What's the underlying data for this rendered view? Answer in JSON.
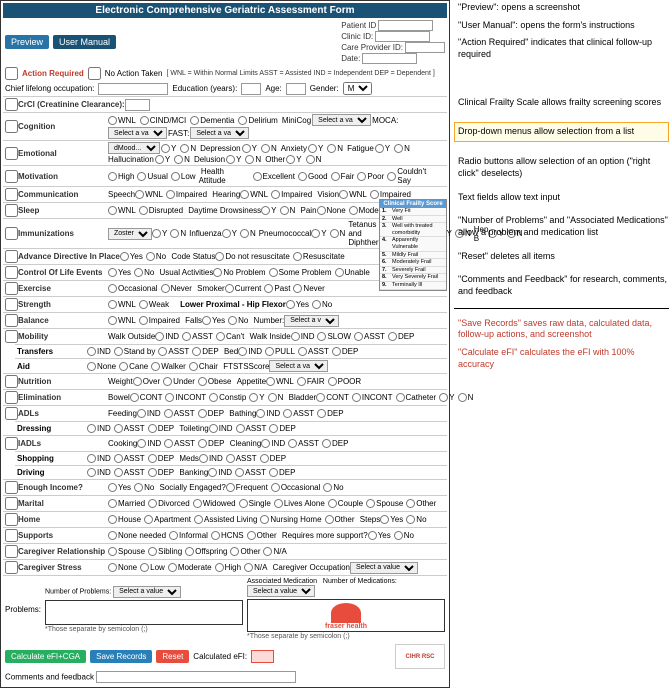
{
  "form": {
    "title": "Electronic Comprehensive Geriatric Assessment Form",
    "buttons": {
      "preview": "Preview",
      "user_manual": "User Manual"
    },
    "patient_id_label": "Patient ID",
    "clinic_id_label": "Clinic ID:",
    "care_provider_label": "Care Provider ID:",
    "date_label": "Date:",
    "action_required": "Action Required",
    "no_action": "No Action Taken",
    "legend": "[ WNL = Within Normal Limits  ASST = Assisted  IND = Independent  DEP = Dependent ]",
    "chief_occupation": "Chief lifelong occupation:",
    "education_label": "Education (years):",
    "age_label": "Age:",
    "gender_label": "Gender:",
    "sections": {
      "crci": "CrCl (Creatinine Clearance):",
      "cognition": "Cognition",
      "emotional": "Emotional",
      "motivation": "Motivation",
      "communication": "Communication",
      "sleep": "Sleep",
      "immunizations": "Immunizations",
      "advance_directive": "Advance Directive In Place",
      "control_of_life": "Control Of Life Events",
      "exercise": "Exercise",
      "strength": "Strength",
      "balance": "Balance",
      "mobility": "Mobility",
      "nutrition": "Nutrition",
      "elimination": "Elimination",
      "adls": "ADLs",
      "iadls": "IADLs",
      "enough_income": "Enough Income?",
      "marital": "Marital",
      "home": "Home",
      "supports": "Supports",
      "caregiver_relationship": "Caregiver Relationship",
      "caregiver_stress": "Caregiver Stress"
    },
    "bottom": {
      "problems_label": "Problems:",
      "num_problems_label": "Number of Problems:",
      "assoc_med_label": "Associated Medication",
      "num_meds_label": "Number of Medications:",
      "calculate_btn": "Calculate eFI+CGA",
      "save_btn": "Save Records",
      "reset_btn": "Reset",
      "calculated_efi": "Calculated eFI:",
      "comments_label": "Comments and feedback"
    }
  },
  "annotations": {
    "preview": "\"Preview\": opens a screenshot",
    "user_manual": "\"User Manual\": opens the form's instructions",
    "action_required": "\"Action Required\" indicates that clinical follow-up required",
    "frailty_scale": "Clinical Frailty Scale allows frailty screening scores",
    "dropdown": "Drop-down menus allow selection from a list",
    "radio": "Radio buttons allow selection of an option (\"right click\" deselects)",
    "text_fields": "Text fields allow text input",
    "num_problems": "\"Number of Problems\" and \"Associated Medications\" allow a problem and medication list",
    "reset": "\"Reset\" deletes all items",
    "comments": "\"Comments and Feedback\" for research, comments, and feedback",
    "save_records": "\"Save Records\" saves raw data, calculated data, follow-up actions, and screenshot",
    "calculate_efi": "\"Calculate eFI\" calculates the eFI with 100% accuracy"
  },
  "frailty_scale": {
    "title": "Clinical Frailty Score",
    "items": [
      {
        "num": "1.",
        "desc": "Very Fit"
      },
      {
        "num": "2.",
        "desc": "Well"
      },
      {
        "num": "3.",
        "desc": "Well with treated comorbidity"
      },
      {
        "num": "4.",
        "desc": "Apparently Vulnerable"
      },
      {
        "num": "5.",
        "desc": "Mildly Frail"
      },
      {
        "num": "6.",
        "desc": "Moderately Frail"
      },
      {
        "num": "7.",
        "desc": "Severely Frail"
      },
      {
        "num": "8.",
        "desc": "Very Severely Frail"
      },
      {
        "num": "9.",
        "desc": "Terminally Ill"
      }
    ]
  }
}
